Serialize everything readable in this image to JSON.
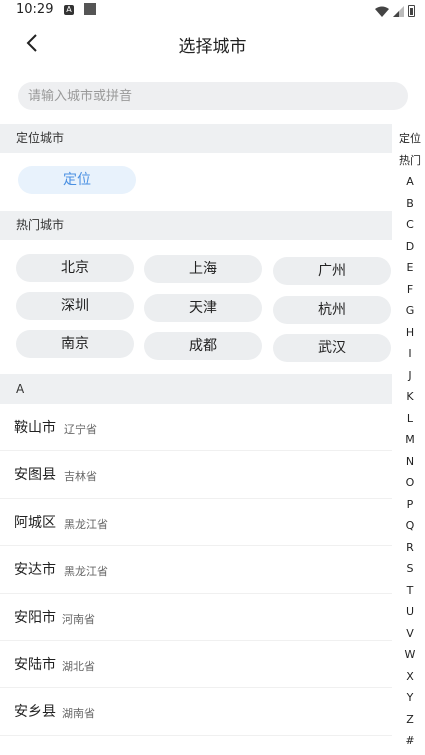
{
  "status_bar": {
    "time": "10:29",
    "a_icon": "A"
  },
  "header": {
    "title": "选择城市"
  },
  "search": {
    "placeholder": "请输入城市或拼音",
    "value": ""
  },
  "location_section": {
    "title": "定位城市",
    "button_label": "定位"
  },
  "hot_section": {
    "title": "热门城市",
    "cities": [
      "北京",
      "上海",
      "广州",
      "深圳",
      "天津",
      "杭州",
      "南京",
      "成都",
      "武汉"
    ]
  },
  "list_section": {
    "letter": "A",
    "cities": [
      {
        "name": "鞍山市",
        "province": "辽宁省"
      },
      {
        "name": "安图县",
        "province": "吉林省"
      },
      {
        "name": "阿城区",
        "province": "黑龙江省"
      },
      {
        "name": "安达市",
        "province": "黑龙江省"
      },
      {
        "name": "安阳市",
        "province": "河南省"
      },
      {
        "name": "安陆市",
        "province": "湖北省"
      },
      {
        "name": "安乡县",
        "province": "湖南省"
      }
    ]
  },
  "index_bar": [
    "定位",
    "热门",
    "A",
    "B",
    "C",
    "D",
    "E",
    "F",
    "G",
    "H",
    "I",
    "J",
    "K",
    "L",
    "M",
    "N",
    "O",
    "P",
    "Q",
    "R",
    "S",
    "T",
    "U",
    "V",
    "W",
    "X",
    "Y",
    "Z",
    "#"
  ],
  "colors": {
    "accent": "#4a90e2",
    "section_bg": "#eef0f2",
    "chip_bg": "#eceef0",
    "loc_chip_bg": "#e8f2fc"
  }
}
